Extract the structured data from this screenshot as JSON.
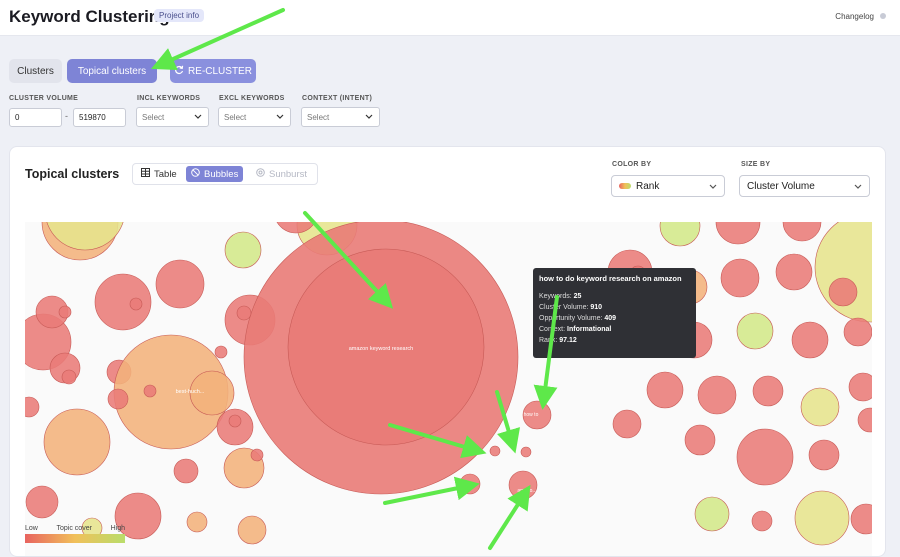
{
  "header": {
    "title": "Keyword Clustering",
    "project_info": "Project info",
    "changelog": "Changelog"
  },
  "tabs": {
    "clusters": "Clusters",
    "topical": "Topical clusters",
    "recluster": "RE-CLUSTER"
  },
  "filters": {
    "cluster_volume_label": "CLUSTER VOLUME",
    "volume_min": "0",
    "volume_max": "519870",
    "incl_label": "INCL KEYWORDS",
    "excl_label": "EXCL KEYWORDS",
    "context_label": "CONTEXT (INTENT)",
    "select_placeholder": "Select"
  },
  "card": {
    "title": "Topical clusters",
    "view_table": "Table",
    "view_bubbles": "Bubbles",
    "view_sunburst": "Sunburst",
    "color_by_label": "COLOR BY",
    "color_by_value": "Rank",
    "size_by_label": "SIZE BY",
    "size_by_value": "Cluster Volume"
  },
  "bubbles": {
    "big_label": "amazon keyword research",
    "left_label": "best-huch...",
    "small_label_1": "how to",
    "small_label_2": "amazo..."
  },
  "tooltip": {
    "title": "how to do keyword research on amazon",
    "keywords_label": "Keywords:",
    "keywords_value": "25",
    "volume_label": "Cluster Volume:",
    "volume_value": "910",
    "opportunity_label": "Opportunity Volume:",
    "opportunity_value": "409",
    "context_label": "Context:",
    "context_value": "Informational",
    "rank_label": "Rank:",
    "rank_value": "97.12"
  },
  "legend": {
    "low": "Low",
    "mid": "Topic cover",
    "high": "High"
  },
  "colors": {
    "accent": "#7e84d6",
    "rank_low": "#e8635f",
    "rank_mid": "#f1c05a",
    "rank_high": "#b9dd6b",
    "annotation_arrow": "#5ee84a"
  }
}
